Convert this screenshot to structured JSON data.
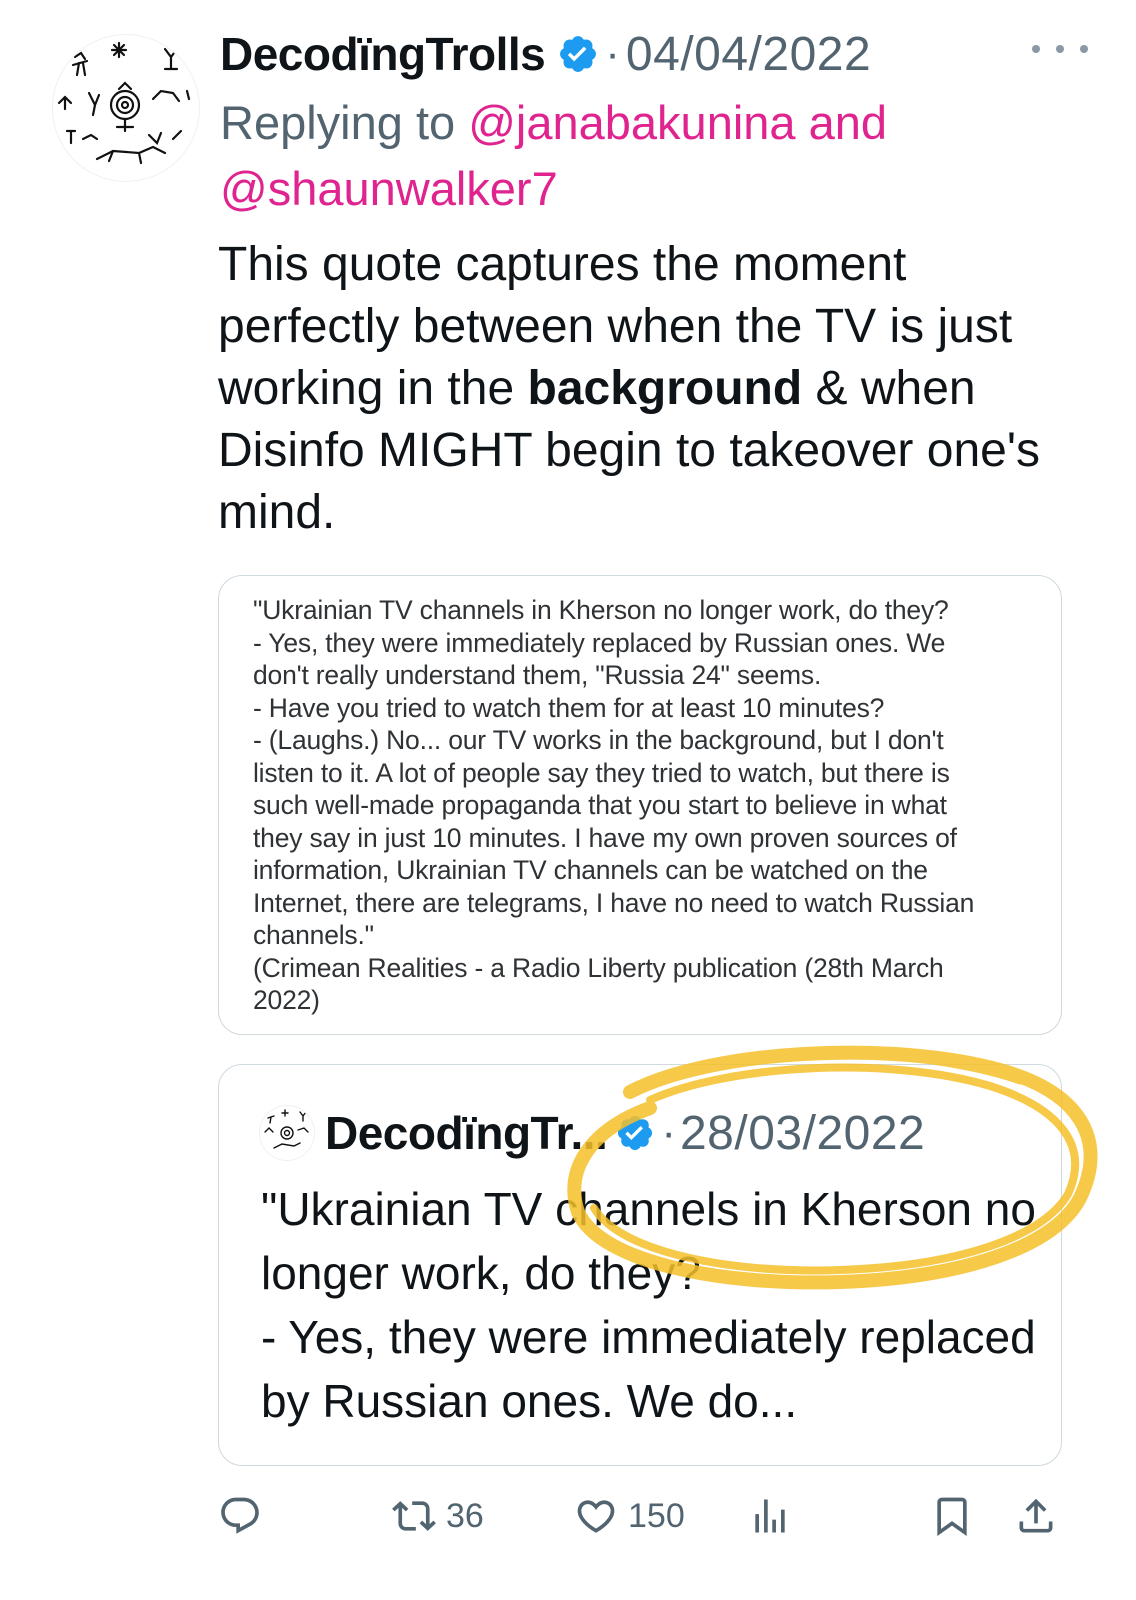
{
  "tweet": {
    "display_name": "DecodïngTrolls",
    "verified_icon": "verified-badge-icon",
    "separator": "·",
    "date": "04/04/2022",
    "replying_prefix": "Replying to ",
    "reply_handle_1": "@janabakunina",
    "reply_and": " and",
    "reply_handle_2": "@shaunwalker7",
    "text_part_1": "This quote captures the moment perfectly between when the TV is just working in the ",
    "text_bold": "background",
    "text_part_2": " & when Disinfo MIGHT begin to takeover one's mind.",
    "handle_color": "#e0248f"
  },
  "image_card": {
    "lines": [
      "\"Ukrainian TV channels in Kherson no longer work, do they?",
      "- Yes, they were immediately replaced by Russian ones. We",
      "don't really understand them, \"Russia 24\" seems.",
      "- Have you tried to watch them for at least 10 minutes?",
      "- (Laughs.) No... our TV works in the background, but I don't",
      "listen to it. A lot of people say they tried to watch, but there is",
      "such well-made propaganda that you start to believe in what",
      "they say in just 10 minutes. I have my own proven sources of",
      "information, Ukrainian TV channels can be watched on the",
      "Internet, there are telegrams, I have no need to watch Russian",
      "channels.\"",
      "(Crimean Realities - a Radio Liberty publication (28th March",
      "2022)"
    ]
  },
  "quoted_tweet": {
    "display_name": "DecodïngTr...",
    "separator": "·",
    "date": "28/03/2022",
    "text": "\"Ukrainian TV channels in Kherson no longer work, do they?\n- Yes, they were immediately replaced by Russian ones. We do..."
  },
  "actions": {
    "reply_icon": "reply-icon",
    "retweet_icon": "retweet-icon",
    "retweet_count": "36",
    "like_icon": "heart-icon",
    "like_count": "150",
    "views_icon": "analytics-icon",
    "bookmark_icon": "bookmark-icon",
    "share_icon": "share-icon"
  },
  "colors": {
    "verified": "#1d9bf0",
    "highlight": "#f5c02a",
    "muted": "#536471"
  }
}
